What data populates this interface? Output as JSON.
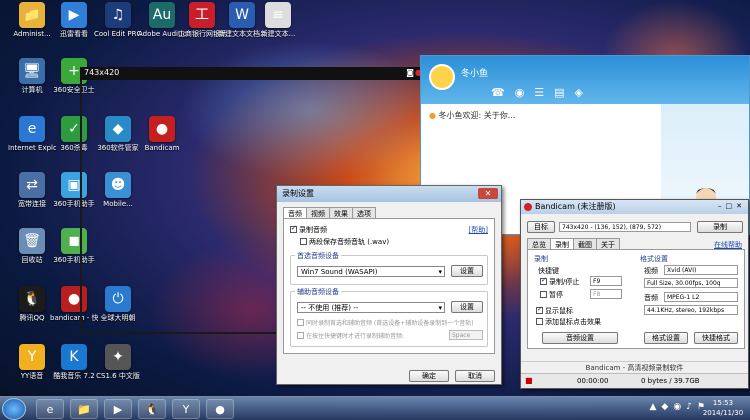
{
  "desktop_icons": [
    {
      "label": "Administ...",
      "icon": "user-folder-icon",
      "color": "#e8b23a",
      "glyph": "📁"
    },
    {
      "label": "迅雷看看",
      "icon": "xunlei-icon",
      "color": "#2f7fd9",
      "glyph": "▶"
    },
    {
      "label": "Cool Edit PRO",
      "icon": "cool-edit-icon",
      "color": "#1c3d7a",
      "glyph": "♫"
    },
    {
      "label": "Adobe Audition 3.0",
      "icon": "adobe-audition-icon",
      "color": "#1d6a6a",
      "glyph": "Au"
    },
    {
      "label": "工商银行网银助手",
      "icon": "icbc-icon",
      "color": "#c8202a",
      "glyph": "工"
    },
    {
      "label": "新建文本文档.docx",
      "icon": "word-doc-icon",
      "color": "#2a5db0",
      "glyph": "W"
    },
    {
      "label": "新建文本...",
      "icon": "text-doc-icon",
      "color": "#ddd",
      "glyph": "≡"
    },
    {
      "label": "计算机",
      "icon": "computer-icon",
      "color": "#3a6ea8",
      "glyph": "🖥"
    },
    {
      "label": "360安全卫士",
      "icon": "360-safe-icon",
      "color": "#3aa83a",
      "glyph": "+"
    },
    {
      "label": "Internet Explorer",
      "icon": "ie-icon",
      "color": "#2b78d4",
      "glyph": "e"
    },
    {
      "label": "360杀毒",
      "icon": "360-antivirus-icon",
      "color": "#2e9c3e",
      "glyph": "✓"
    },
    {
      "label": "360软件管家",
      "icon": "360-software-icon",
      "color": "#2a8ac8",
      "glyph": "◆"
    },
    {
      "label": "Bandicam",
      "icon": "bandicam-icon",
      "color": "#c51f1f",
      "glyph": "●"
    },
    {
      "label": "宽带连接",
      "icon": "network-icon",
      "color": "#4a6fa5",
      "glyph": "⇄"
    },
    {
      "label": "360手机助手",
      "icon": "360-phone-icon",
      "color": "#3aa3e0",
      "glyph": "▣"
    },
    {
      "label": "Mobile...",
      "icon": "mobile-icon",
      "color": "#3b8fd4",
      "glyph": "☻"
    },
    {
      "label": "回收站",
      "icon": "recycle-bin-icon",
      "color": "#6b8db5",
      "glyph": "🗑"
    },
    {
      "label": "360手机助手",
      "icon": "360-phone-2-icon",
      "color": "#4fb04f",
      "glyph": "◼"
    },
    {
      "label": "腾讯QQ",
      "icon": "qq-icon",
      "color": "#1b1b1b",
      "glyph": "🐧"
    },
    {
      "label": "bandicam - 快捷方式",
      "icon": "bandicam-shortcut-icon",
      "color": "#b82020",
      "glyph": "●"
    },
    {
      "label": "全球大明朝",
      "icon": "power-icon",
      "color": "#2a7ad0",
      "glyph": "⏻"
    },
    {
      "label": "YY语音",
      "icon": "yy-icon",
      "color": "#f0b020",
      "glyph": "Y"
    },
    {
      "label": "酷我音乐 7.2",
      "icon": "kuwo-icon",
      "color": "#1b78d0",
      "glyph": "K"
    },
    {
      "label": "CS1.6 中文版",
      "icon": "cs-icon",
      "color": "#555",
      "glyph": "✦"
    }
  ],
  "recording_bar": {
    "size_text": "743x420",
    "rec_label": "REC"
  },
  "qq_window": {
    "contact_name": "冬小鱼",
    "notice": "冬小鱼欢迎: 关于你..."
  },
  "settings_dialog": {
    "title": "录制设置",
    "close_label": "✕",
    "tabs": [
      "音频",
      "视频",
      "效果",
      "选项"
    ],
    "record_audio_label": "录制音频",
    "record_audio_checked": true,
    "help_link": "[帮助]",
    "two_track_label": "两段保存音频音轨 (.wav)",
    "main_device_group": "首选音频设备",
    "main_device_value": "Win7 Sound (WASAPI)",
    "settings_button_1": "设置",
    "secondary_group": "辅助音频设备",
    "secondary_value": "-- 不使用 (推荐) --",
    "settings_button_2": "设置",
    "mix_label": "同时录制首选和辅助音频 (首选设备+辅助设备录制到一个音轨)",
    "hotkey_label": "在按住快捷键时才进行录制辅助音频:",
    "hotkey_value": "Space",
    "ok_button": "确定",
    "cancel_button": "取消"
  },
  "bandicam": {
    "title": "Bandicam (未注册版)",
    "target_label": "目标",
    "target_value": "743x420 - (136, 152), (879, 572)",
    "record_button": "录制",
    "tabs": [
      "总览",
      "录制",
      "截图",
      "关于"
    ],
    "register_link": "在线帮助",
    "record_group": "录制",
    "hotkey_label": "快捷键",
    "hotkey_checkbox": "录制/停止",
    "hotkey_value": "F9",
    "pause_label": "暂停",
    "pause_value": "F8",
    "show_cursor_label": "显示鼠标",
    "click_effect_label": "添加鼠标点击效果",
    "audio_settings_button": "音频设置",
    "format_group": "格式设置",
    "format_label": "视频",
    "format_value": "Xvid (AVI)",
    "video_text": "Full Size, 30.00fps, 100q",
    "audio_label": "音频",
    "audio_text": "MPEG-1 L2",
    "audio_detail": "44.1KHz, stereo, 192kbps",
    "format_settings_button": "格式设置",
    "quick_format_button": "快捷格式",
    "status_text": "Bandicam - 高清视频录制软件",
    "timer": "00:00:00",
    "size": "0 bytes / 39.7GB"
  },
  "taskbar": {
    "apps": [
      {
        "icon": "ie-taskbar-icon",
        "glyph": "e"
      },
      {
        "icon": "folder-taskbar-icon",
        "glyph": "📁"
      },
      {
        "icon": "media-taskbar-icon",
        "glyph": "▶"
      },
      {
        "icon": "qq-taskbar-icon",
        "glyph": "🐧"
      },
      {
        "icon": "yy-taskbar-icon",
        "glyph": "Y"
      },
      {
        "icon": "bandicam-taskbar-icon",
        "glyph": "●"
      }
    ],
    "time": "15:53",
    "date": "2014/11/30"
  }
}
